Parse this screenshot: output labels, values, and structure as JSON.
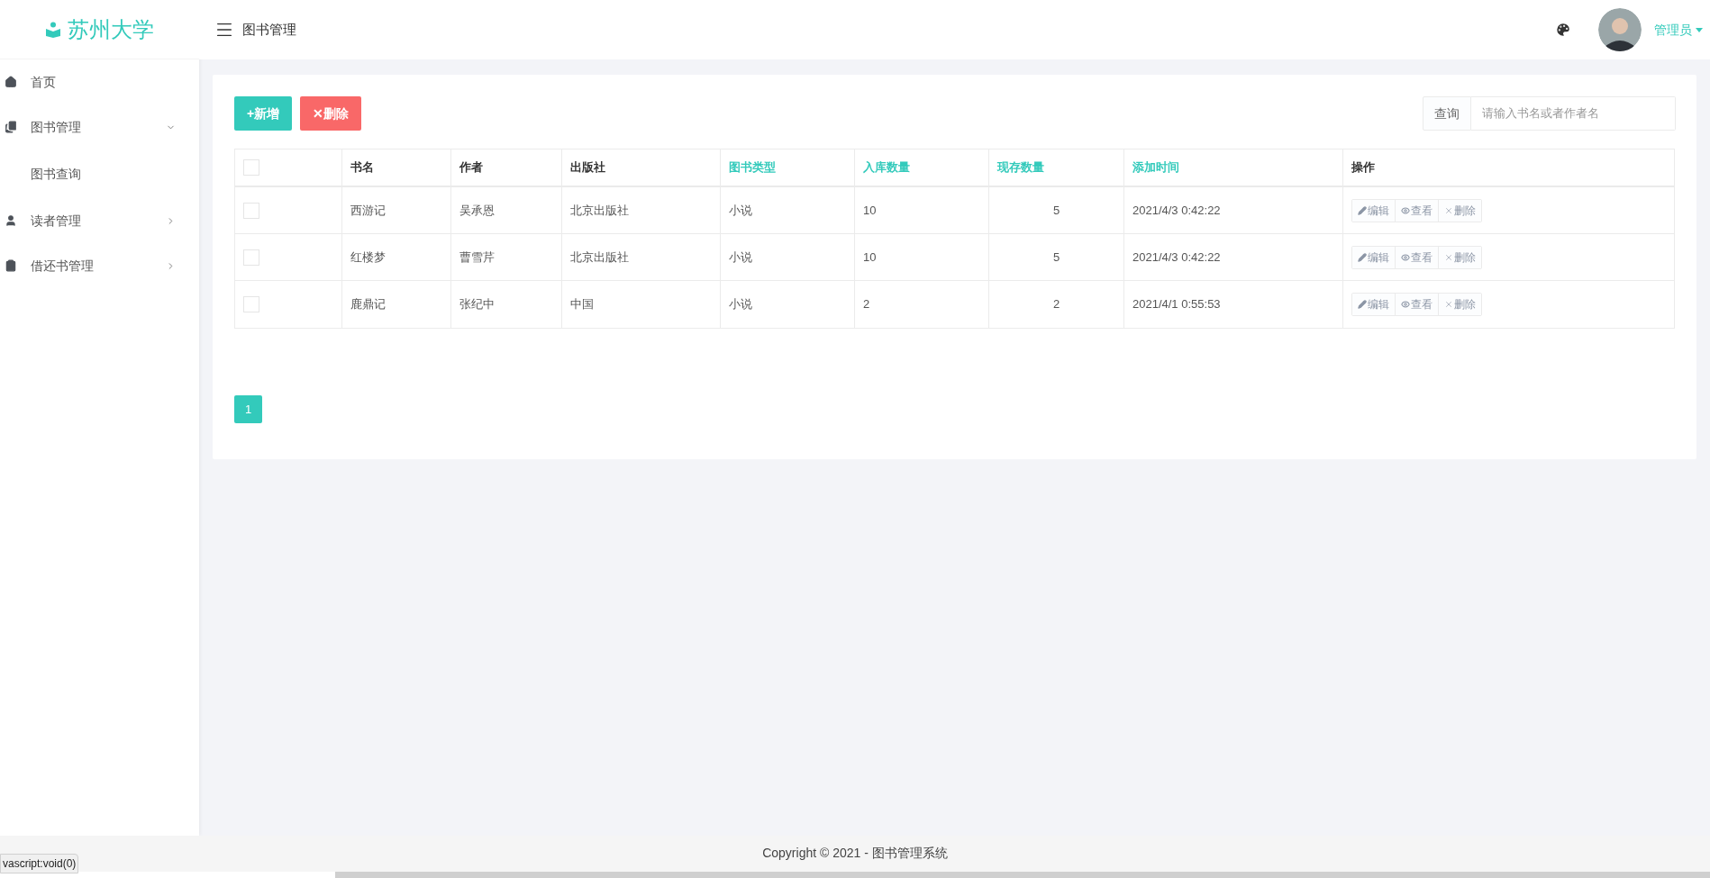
{
  "brand": {
    "title": "苏州大学"
  },
  "sidebar": {
    "items": [
      {
        "label": "首页"
      },
      {
        "label": "图书管理",
        "expanded": true,
        "children": [
          {
            "label": "图书查询"
          }
        ]
      },
      {
        "label": "读者管理",
        "expanded": false
      },
      {
        "label": "借还书管理",
        "expanded": false
      }
    ]
  },
  "header": {
    "title": "图书管理",
    "user": "管理员"
  },
  "toolbar": {
    "add": "+新增",
    "delete": "✕删除",
    "search_label": "查询",
    "search_placeholder": "请输入书名或者作者名"
  },
  "table": {
    "select_all": {
      "checked": false
    },
    "columns": [
      {
        "label": "书名",
        "sortable": false,
        "kind": "text"
      },
      {
        "label": "作者",
        "sortable": false,
        "kind": "text"
      },
      {
        "label": "出版社",
        "sortable": false,
        "kind": "text"
      },
      {
        "label": "图书类型",
        "sortable": true,
        "kind": "text"
      },
      {
        "label": "入库数量",
        "sortable": true,
        "kind": "text"
      },
      {
        "label": "现存数量",
        "sortable": true,
        "kind": "centered"
      },
      {
        "label": "添加时间",
        "sortable": true,
        "kind": "text"
      },
      {
        "label": "操作",
        "sortable": false,
        "kind": "actions"
      }
    ],
    "rows": [
      {
        "checked": false,
        "cells": [
          "西游记",
          "吴承恩",
          "北京出版社",
          "小说",
          "10",
          "5",
          "2021/4/3 0:42:22"
        ],
        "actions": [
          "编辑",
          "查看",
          "删除"
        ]
      },
      {
        "checked": false,
        "cells": [
          "红楼梦",
          "曹雪芹",
          "北京出版社",
          "小说",
          "10",
          "5",
          "2021/4/3 0:42:22"
        ],
        "actions": [
          "编辑",
          "查看",
          "删除"
        ]
      },
      {
        "checked": false,
        "cells": [
          "鹿鼎记",
          "张纪中",
          "中国",
          "小说",
          "2",
          "2",
          "2021/4/1 0:55:53"
        ],
        "actions": [
          "编辑",
          "查看",
          "删除"
        ]
      }
    ]
  },
  "pagination": [
    {
      "label": "1",
      "selected": true
    }
  ],
  "footer": "Copyright © 2021 - 图书管理系统",
  "status_bar": "vascript:void(0)"
}
